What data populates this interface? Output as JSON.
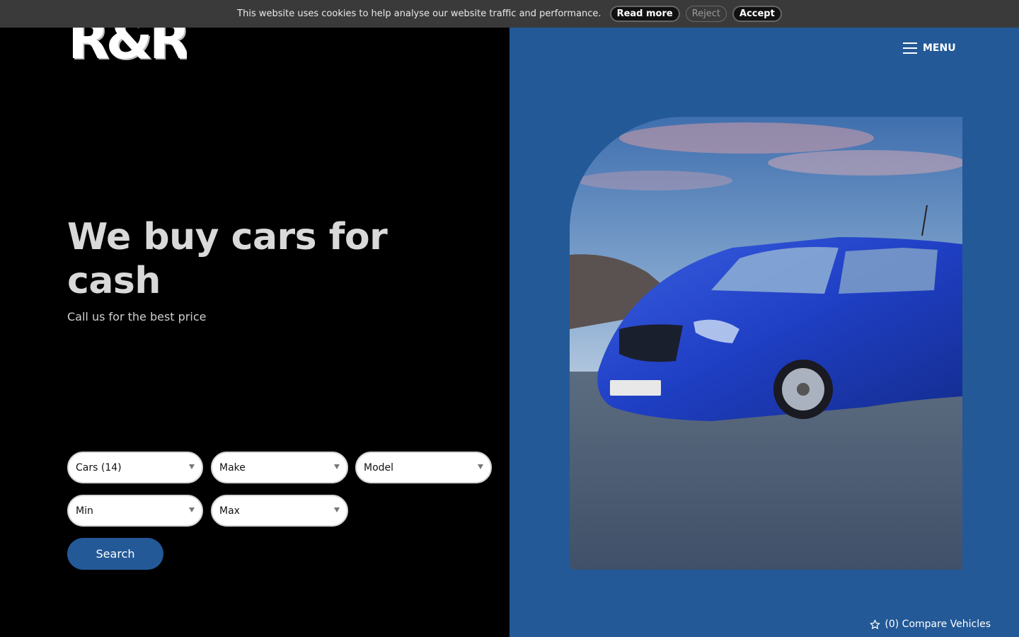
{
  "cookie": {
    "text": "This website uses cookies to help analyse our website traffic and performance.",
    "read_more": "Read more",
    "reject": "Reject",
    "accept": "Accept"
  },
  "logo": {
    "text": "R&R"
  },
  "hero": {
    "title": "We buy cars for cash",
    "subtitle": "Call us for the best price"
  },
  "search": {
    "filters": [
      {
        "label": "Cars (14)"
      },
      {
        "label": "Make"
      },
      {
        "label": "Model"
      },
      {
        "label": "Min"
      },
      {
        "label": "Max"
      }
    ],
    "button_label": "Search"
  },
  "nav": {
    "menu_label": "MENU"
  },
  "compare": {
    "label": "(0) Compare Vehicles"
  },
  "colors": {
    "brand_blue": "#235997",
    "background_left": "#000000",
    "cookie_bar": "#3a3a3a"
  },
  "icons": {
    "menu": "hamburger-icon",
    "compare": "star-outline-icon",
    "select_caret": "caret-down-icon"
  }
}
